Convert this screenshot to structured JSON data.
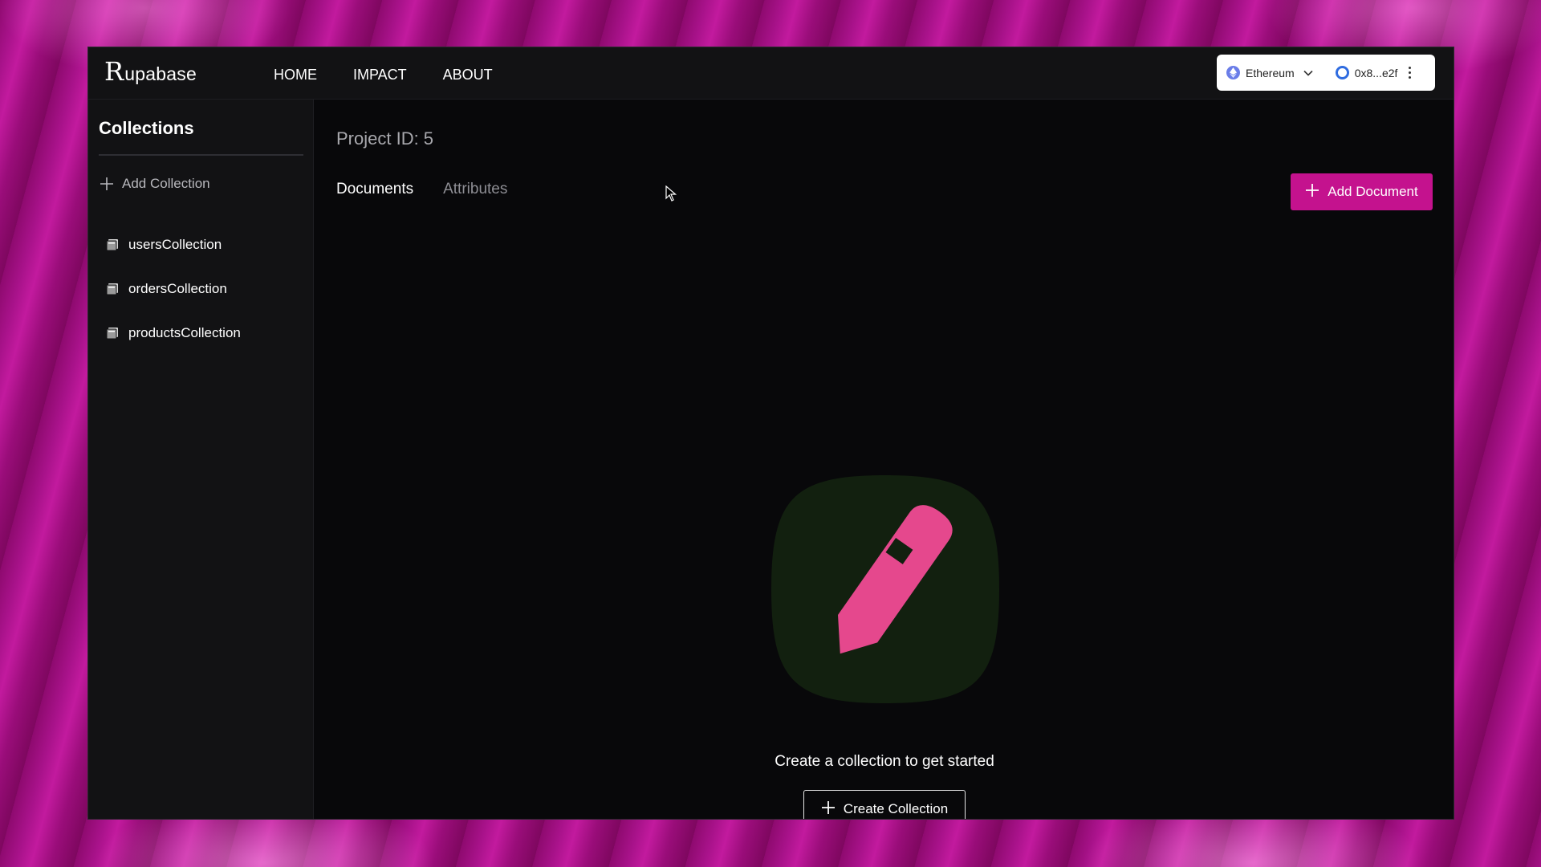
{
  "app": {
    "logo_mark": "R",
    "logo_rest": "upabase"
  },
  "nav": {
    "items": [
      {
        "label": "HOME"
      },
      {
        "label": "IMPACT"
      },
      {
        "label": "ABOUT"
      }
    ]
  },
  "wallet": {
    "chain_label": "Ethereum",
    "address_label": "0x8...e2f",
    "chain_icon": "ethereum-icon",
    "address_icon": "wallet-ring-icon"
  },
  "sidebar": {
    "title": "Collections",
    "add_label": "Add Collection",
    "items": [
      {
        "label": "usersCollection"
      },
      {
        "label": "ordersCollection"
      },
      {
        "label": "productsCollection"
      }
    ]
  },
  "main": {
    "project_id": "Project ID: 5",
    "tabs": [
      {
        "label": "Documents",
        "active": true
      },
      {
        "label": "Attributes",
        "active": false
      }
    ],
    "add_document_label": "Add Document",
    "empty_message": "Create a collection to get started",
    "create_collection_label": "Create Collection"
  },
  "colors": {
    "accent": "#c4128e",
    "illustration_bg": "#12200f",
    "pencil": "#e5488d",
    "window_bg": "#08080a",
    "panel_bg": "#121214"
  }
}
